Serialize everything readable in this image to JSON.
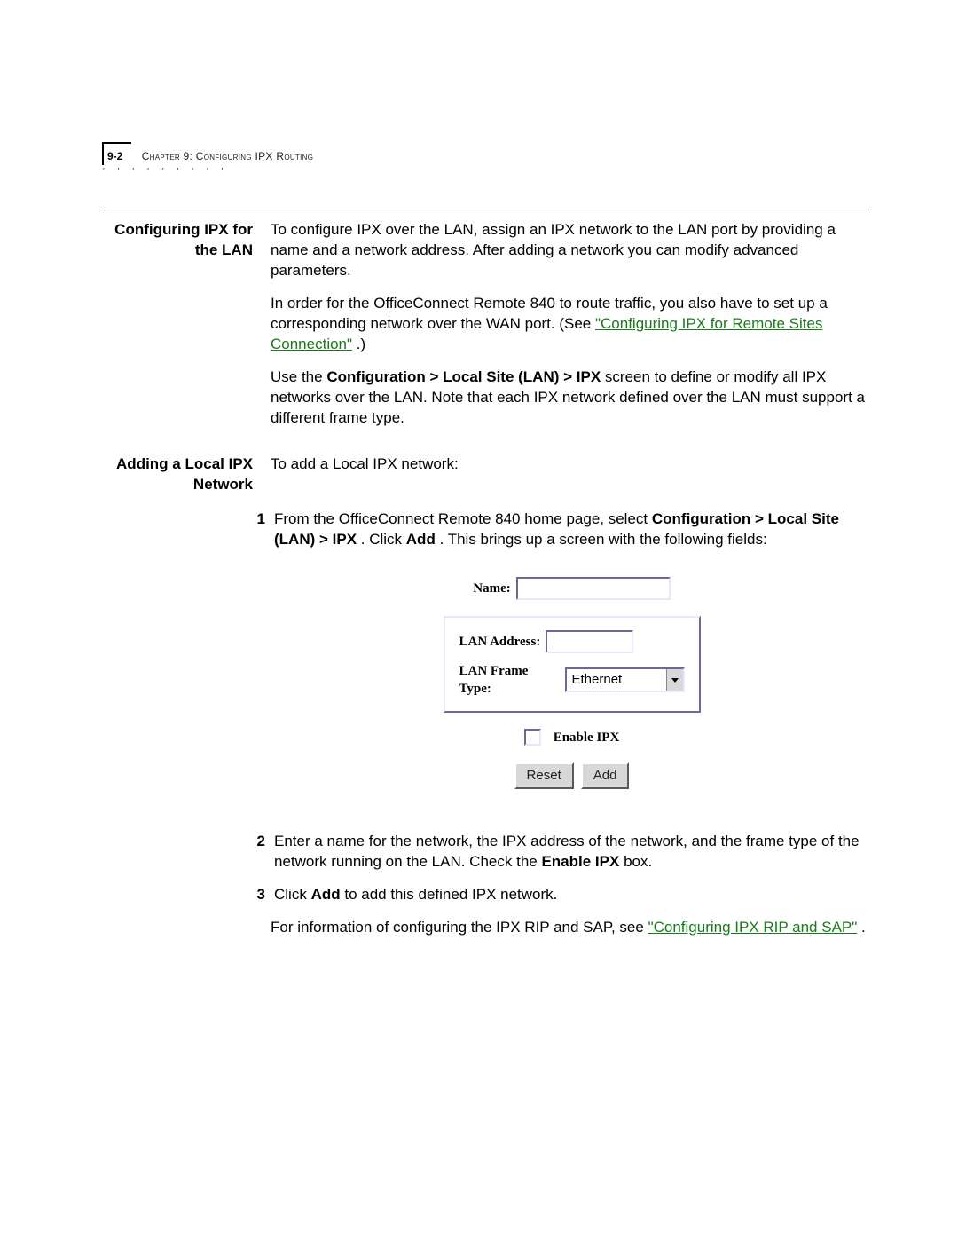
{
  "header": {
    "page_no": "9-2",
    "chapter_label": "Chapter 9: Configuring IPX Routing"
  },
  "section1": {
    "heading": "Configuring IPX for the LAN",
    "para1": "To configure IPX over the LAN, assign an IPX network to the LAN port by providing a name and a network address. After adding a network you can modify advanced parameters.",
    "para2a": "In order for the OfficeConnect Remote 840 to route traffic, you also have to set up a corresponding network over the WAN port. (See ",
    "link1": "\"Configuring IPX for Remote Sites Connection\"",
    "para2b": ".)",
    "para3a": "Use the ",
    "bold3": "Configuration > Local Site (LAN) > IPX",
    "para3b": " screen to define or modify all IPX networks over the LAN. Note that each IPX network defined over the LAN must support a different frame type."
  },
  "section2": {
    "heading": "Adding a Local IPX Network",
    "intro": "To add a Local IPX network:",
    "steps": {
      "s1": {
        "n": "1",
        "a": "From the OfficeConnect Remote 840 home page, select ",
        "b1": "Configuration > Local Site (LAN) > IPX",
        "mid": ". Click ",
        "b2": "Add",
        "c": ". This brings up a screen with the following fields:"
      },
      "s2": {
        "n": "2",
        "a": "Enter a name for the network, the IPX address of the network, and the frame type of the network running on the LAN. Check the ",
        "b": "Enable IPX",
        "c": " box."
      },
      "s3": {
        "n": "3",
        "a": "Click ",
        "b": "Add",
        "c": " to add this defined IPX network."
      }
    },
    "tail_a": "For information of configuring the IPX RIP and SAP, see ",
    "tail_link": "\"Configuring IPX RIP and SAP\"",
    "tail_b": "."
  },
  "form": {
    "name_label": "Name:",
    "addr_label": "LAN Address:",
    "frame_label": "LAN Frame Type:",
    "frame_value": "Ethernet",
    "enable_label": "Enable IPX",
    "reset": "Reset",
    "add": "Add"
  }
}
